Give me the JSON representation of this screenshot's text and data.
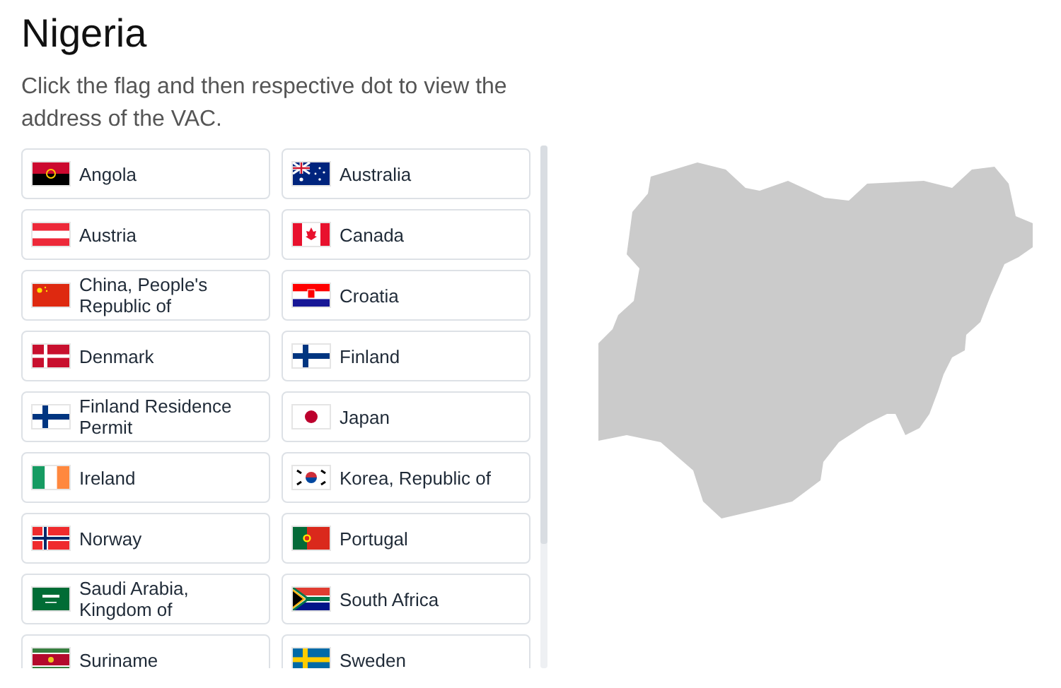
{
  "title": "Nigeria",
  "instructions": "Click the flag and then respective dot to view the address of the VAC.",
  "countries": [
    {
      "label": "Angola",
      "kind": "angola"
    },
    {
      "label": "Australia",
      "kind": "australia"
    },
    {
      "label": "Austria",
      "kind": "austria"
    },
    {
      "label": "Canada",
      "kind": "canada"
    },
    {
      "label": "China, People's Republic of",
      "kind": "china"
    },
    {
      "label": "Croatia",
      "kind": "croatia"
    },
    {
      "label": "Denmark",
      "kind": "denmark"
    },
    {
      "label": "Finland",
      "kind": "finland"
    },
    {
      "label": "Finland Residence Permit",
      "kind": "finland"
    },
    {
      "label": "Japan",
      "kind": "japan"
    },
    {
      "label": "Ireland",
      "kind": "ireland"
    },
    {
      "label": "Korea, Republic of",
      "kind": "korea"
    },
    {
      "label": "Norway",
      "kind": "norway"
    },
    {
      "label": "Portugal",
      "kind": "portugal"
    },
    {
      "label": "Saudi Arabia, Kingdom of",
      "kind": "saudi"
    },
    {
      "label": "South Africa",
      "kind": "southafrica"
    },
    {
      "label": "Suriname",
      "kind": "suriname"
    },
    {
      "label": "Sweden",
      "kind": "sweden"
    }
  ],
  "map": {
    "kind": "nigeria"
  }
}
